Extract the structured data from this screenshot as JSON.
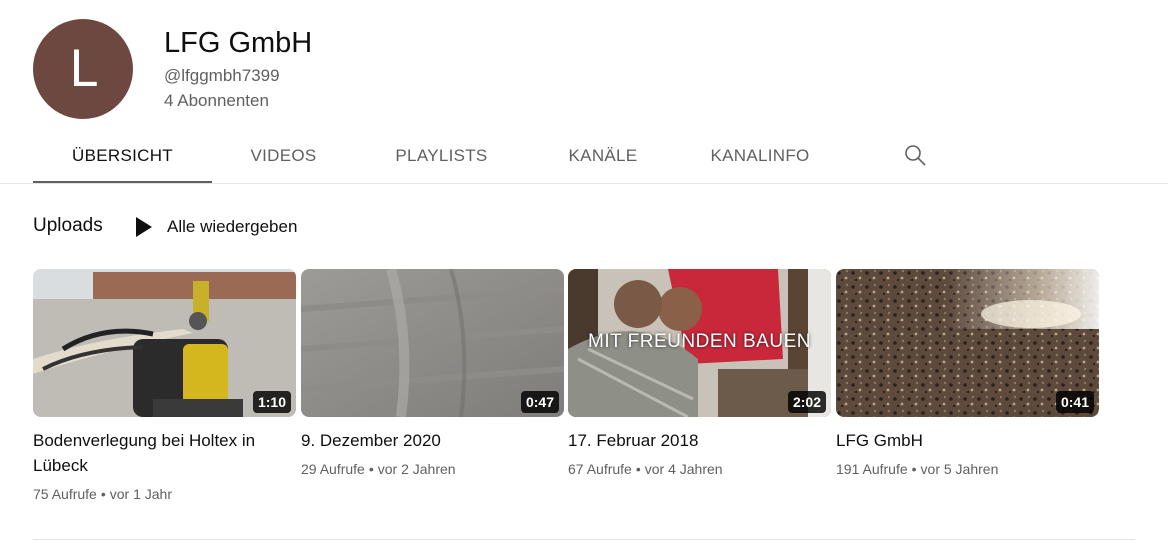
{
  "channel": {
    "avatar_letter": "L",
    "avatar_color": "#6d4841",
    "name": "LFG GmbH",
    "handle": "@lfggmbh7399",
    "subscribers": "4 Abonnenten"
  },
  "tabs": [
    {
      "label": "ÜBERSICHT",
      "active": true
    },
    {
      "label": "VIDEOS",
      "active": false
    },
    {
      "label": "PLAYLISTS",
      "active": false
    },
    {
      "label": "KANÄLE",
      "active": false
    },
    {
      "label": "KANALINFO",
      "active": false
    }
  ],
  "search_icon": "search-icon",
  "section": {
    "title": "Uploads",
    "play_all_label": "Alle wiedergeben"
  },
  "videos": [
    {
      "title": "Bodenverlegung bei Holtex in Lübeck",
      "duration": "1:10",
      "views": "75 Aufrufe",
      "age": "vor 1 Jahr",
      "overlay": ""
    },
    {
      "title": "9. Dezember 2020",
      "duration": "0:47",
      "views": "29 Aufrufe",
      "age": "vor 2 Jahren",
      "overlay": ""
    },
    {
      "title": "17. Februar 2018",
      "duration": "2:02",
      "views": "67 Aufrufe",
      "age": "vor 4 Jahren",
      "overlay": "MIT FREUNDEN BAUEN"
    },
    {
      "title": "LFG GmbH",
      "duration": "0:41",
      "views": "191 Aufrufe",
      "age": "vor 5 Jahren",
      "overlay": ""
    }
  ],
  "meta_separator": "•"
}
